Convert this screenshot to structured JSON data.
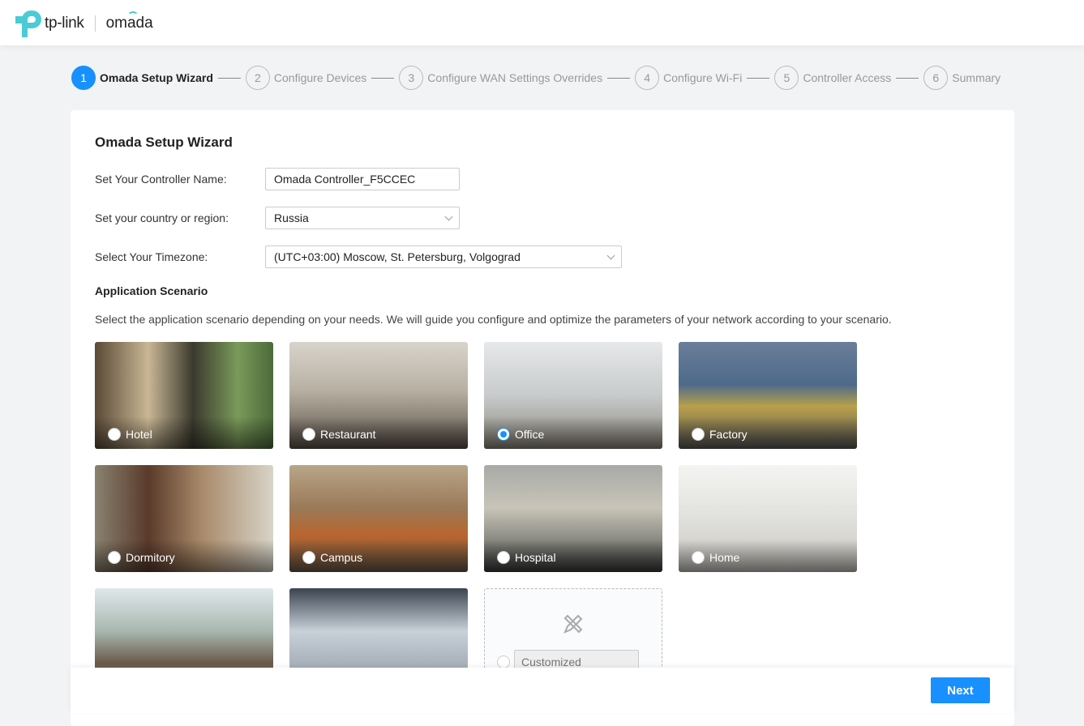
{
  "header": {
    "brand": "tp-link",
    "product": "omada"
  },
  "steps": [
    {
      "num": "1",
      "label": "Omada Setup Wizard",
      "active": true
    },
    {
      "num": "2",
      "label": "Configure Devices"
    },
    {
      "num": "3",
      "label": "Configure WAN Settings Overrides"
    },
    {
      "num": "4",
      "label": "Configure Wi-Fi"
    },
    {
      "num": "5",
      "label": "Controller Access"
    },
    {
      "num": "6",
      "label": "Summary"
    }
  ],
  "form": {
    "title": "Omada Setup Wizard",
    "name_label": "Set Your Controller Name:",
    "name_value": "Omada Controller_F5CCEC",
    "country_label": "Set your country or region:",
    "country_value": "Russia",
    "tz_label": "Select Your Timezone:",
    "tz_value": "(UTC+03:00) Moscow, St. Petersburg, Volgograd"
  },
  "scenario": {
    "title": "Application Scenario",
    "desc": "Select the application scenario depending on your needs. We will guide you configure and optimize the parameters of your network according to your scenario.",
    "items": [
      {
        "label": "Hotel"
      },
      {
        "label": "Restaurant"
      },
      {
        "label": "Office",
        "selected": true
      },
      {
        "label": "Factory"
      },
      {
        "label": "Dormitory"
      },
      {
        "label": "Campus"
      },
      {
        "label": "Hospital"
      },
      {
        "label": "Home"
      }
    ],
    "customized_placeholder": "Customized"
  },
  "footer": {
    "next": "Next"
  },
  "colors": {
    "accent": "#1890ff",
    "brand": "#4acbd6"
  }
}
